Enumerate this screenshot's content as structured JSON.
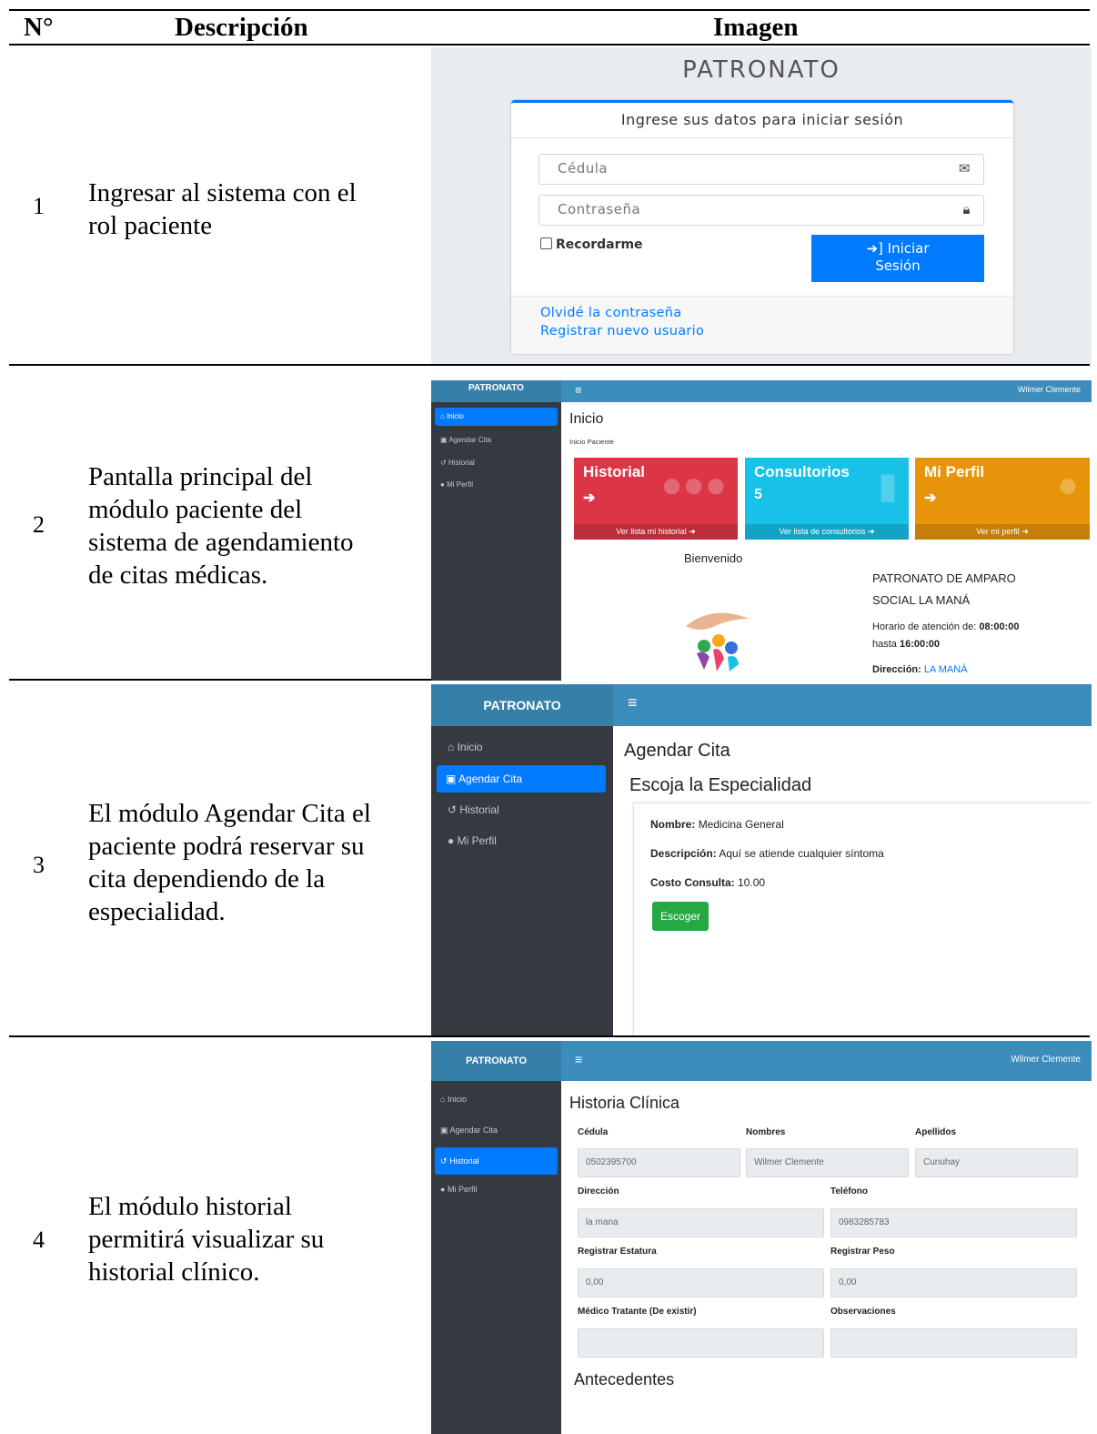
{
  "table": {
    "headers": {
      "num": "N°",
      "desc": "Descripción",
      "image": "Imagen"
    },
    "rows": [
      {
        "num": "1",
        "desc": [
          "Ingresar al sistema con el",
          "rol paciente"
        ]
      },
      {
        "num": "2",
        "desc": [
          "Pantalla principal del",
          "módulo paciente del",
          "sistema de agendamiento",
          "de citas médicas."
        ]
      },
      {
        "num": "3",
        "desc": [
          "El módulo Agendar Cita el",
          "paciente podrá reservar su",
          "cita dependiendo de la",
          "especialidad."
        ]
      },
      {
        "num": "4",
        "desc": [
          "El módulo historial",
          "permitirá visualizar su",
          "historial clínico."
        ]
      }
    ]
  },
  "login": {
    "title": "PATRONATO",
    "card_header": "Ingrese sus datos para iniciar sesión",
    "cedula_placeholder": "Cédula",
    "password_placeholder": "Contraseña",
    "remember": "Recordarme",
    "submit": [
      "Iniciar",
      "Sesión"
    ],
    "forgot": "Olvidé la contraseña",
    "register": "Registrar nuevo usuario"
  },
  "app": {
    "brand": "PATRONATO",
    "menu_icon": "≡",
    "user": "Wilmer Clemente",
    "nav": [
      "Inicio",
      "Agendar Cita",
      "Historial",
      "Mi Perfil"
    ]
  },
  "home": {
    "title": "Inicio",
    "breadcrumb": "Inicio Paciente",
    "boxes": [
      {
        "title": "Historial",
        "value": "",
        "footer": "Ver lista mi historial",
        "color": "#dc3545"
      },
      {
        "title": "Consultorios",
        "value": "5",
        "footer": "Ver lista de consultorios",
        "color": "#17c1e8"
      },
      {
        "title": "Mi Perfil",
        "value": "",
        "footer": "Ver mi perfil",
        "color": "#e8940a"
      }
    ],
    "welcome": "Bienvenido",
    "org": [
      "PATRONATO DE AMPARO",
      "SOCIAL LA MANÁ"
    ],
    "hours_label": "Horario de atención de:",
    "hours_from": "08:00:00",
    "hours_to_label": "hasta",
    "hours_to": "16:00:00",
    "address_label": "Dirección:",
    "address": "LA MANÁ"
  },
  "agendar": {
    "title": "Agendar Cita",
    "subtitle": "Escoja la Especialidad",
    "name_label": "Nombre:",
    "name": "Medicina General",
    "desc_label": "Descripción:",
    "desc": "Aquí se atiende cualquier síntoma",
    "cost_label": "Costo Consulta:",
    "cost": "10.00",
    "button": "Escoger"
  },
  "historia": {
    "title": "Historia Clínica",
    "fields": {
      "cedula_label": "Cédula",
      "cedula": "0502395700",
      "nombres_label": "Nombres",
      "nombres": "Wilmer Clemente",
      "apellidos_label": "Apellidos",
      "apellidos": "Cunuhay",
      "direccion_label": "Dirección",
      "direccion": "la mana",
      "telefono_label": "Teléfono",
      "telefono": "0983285783",
      "estatura_label": "Registrar Estatura",
      "estatura": "0,00",
      "peso_label": "Registrar Peso",
      "peso": "0,00",
      "medico_label": "Médico Tratante (De existir)",
      "obs_label": "Observaciones"
    },
    "antecedentes": "Antecedentes"
  }
}
